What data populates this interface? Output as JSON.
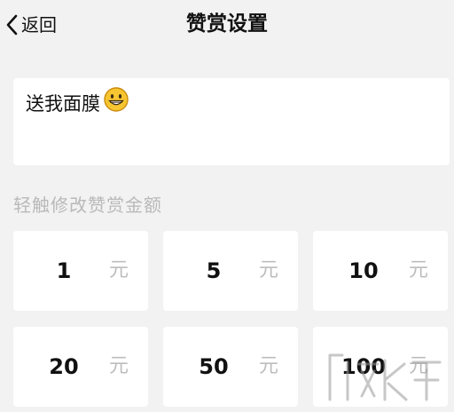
{
  "header": {
    "back_label": "返回",
    "title": "赞赏设置"
  },
  "message": {
    "text": "送我面膜",
    "emoji": "grinning-face"
  },
  "amount_section": {
    "hint": "轻触修改赞赏金额",
    "unit": "元",
    "amounts": [
      "1",
      "5",
      "10",
      "20",
      "50",
      "100"
    ]
  },
  "colors": {
    "background": "#f2f2f2",
    "card": "#ffffff",
    "hint_text": "#b9b9b9",
    "unit_text": "#bdbdbd"
  }
}
